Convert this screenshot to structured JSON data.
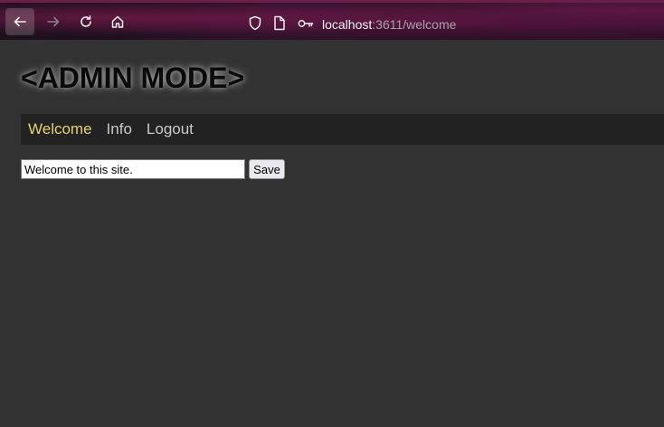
{
  "browser": {
    "url_host": "localhost",
    "url_rest": ":3611/welcome",
    "icons": [
      "back-arrow-icon",
      "forward-arrow-icon",
      "reload-icon",
      "home-icon",
      "shield-icon",
      "page-icon",
      "key-icon"
    ]
  },
  "page": {
    "title": "<ADMIN MODE>",
    "nav": {
      "items": [
        {
          "label": "Welcome",
          "active": true
        },
        {
          "label": "Info",
          "active": false
        },
        {
          "label": "Logout",
          "active": false
        }
      ]
    },
    "form": {
      "welcome_value": "Welcome to this site.",
      "save_label": "Save"
    }
  },
  "colors": {
    "page_background": "#323232",
    "nav_background": "#222222",
    "active_link": "#e6d36e",
    "link": "#c9c9c9"
  }
}
